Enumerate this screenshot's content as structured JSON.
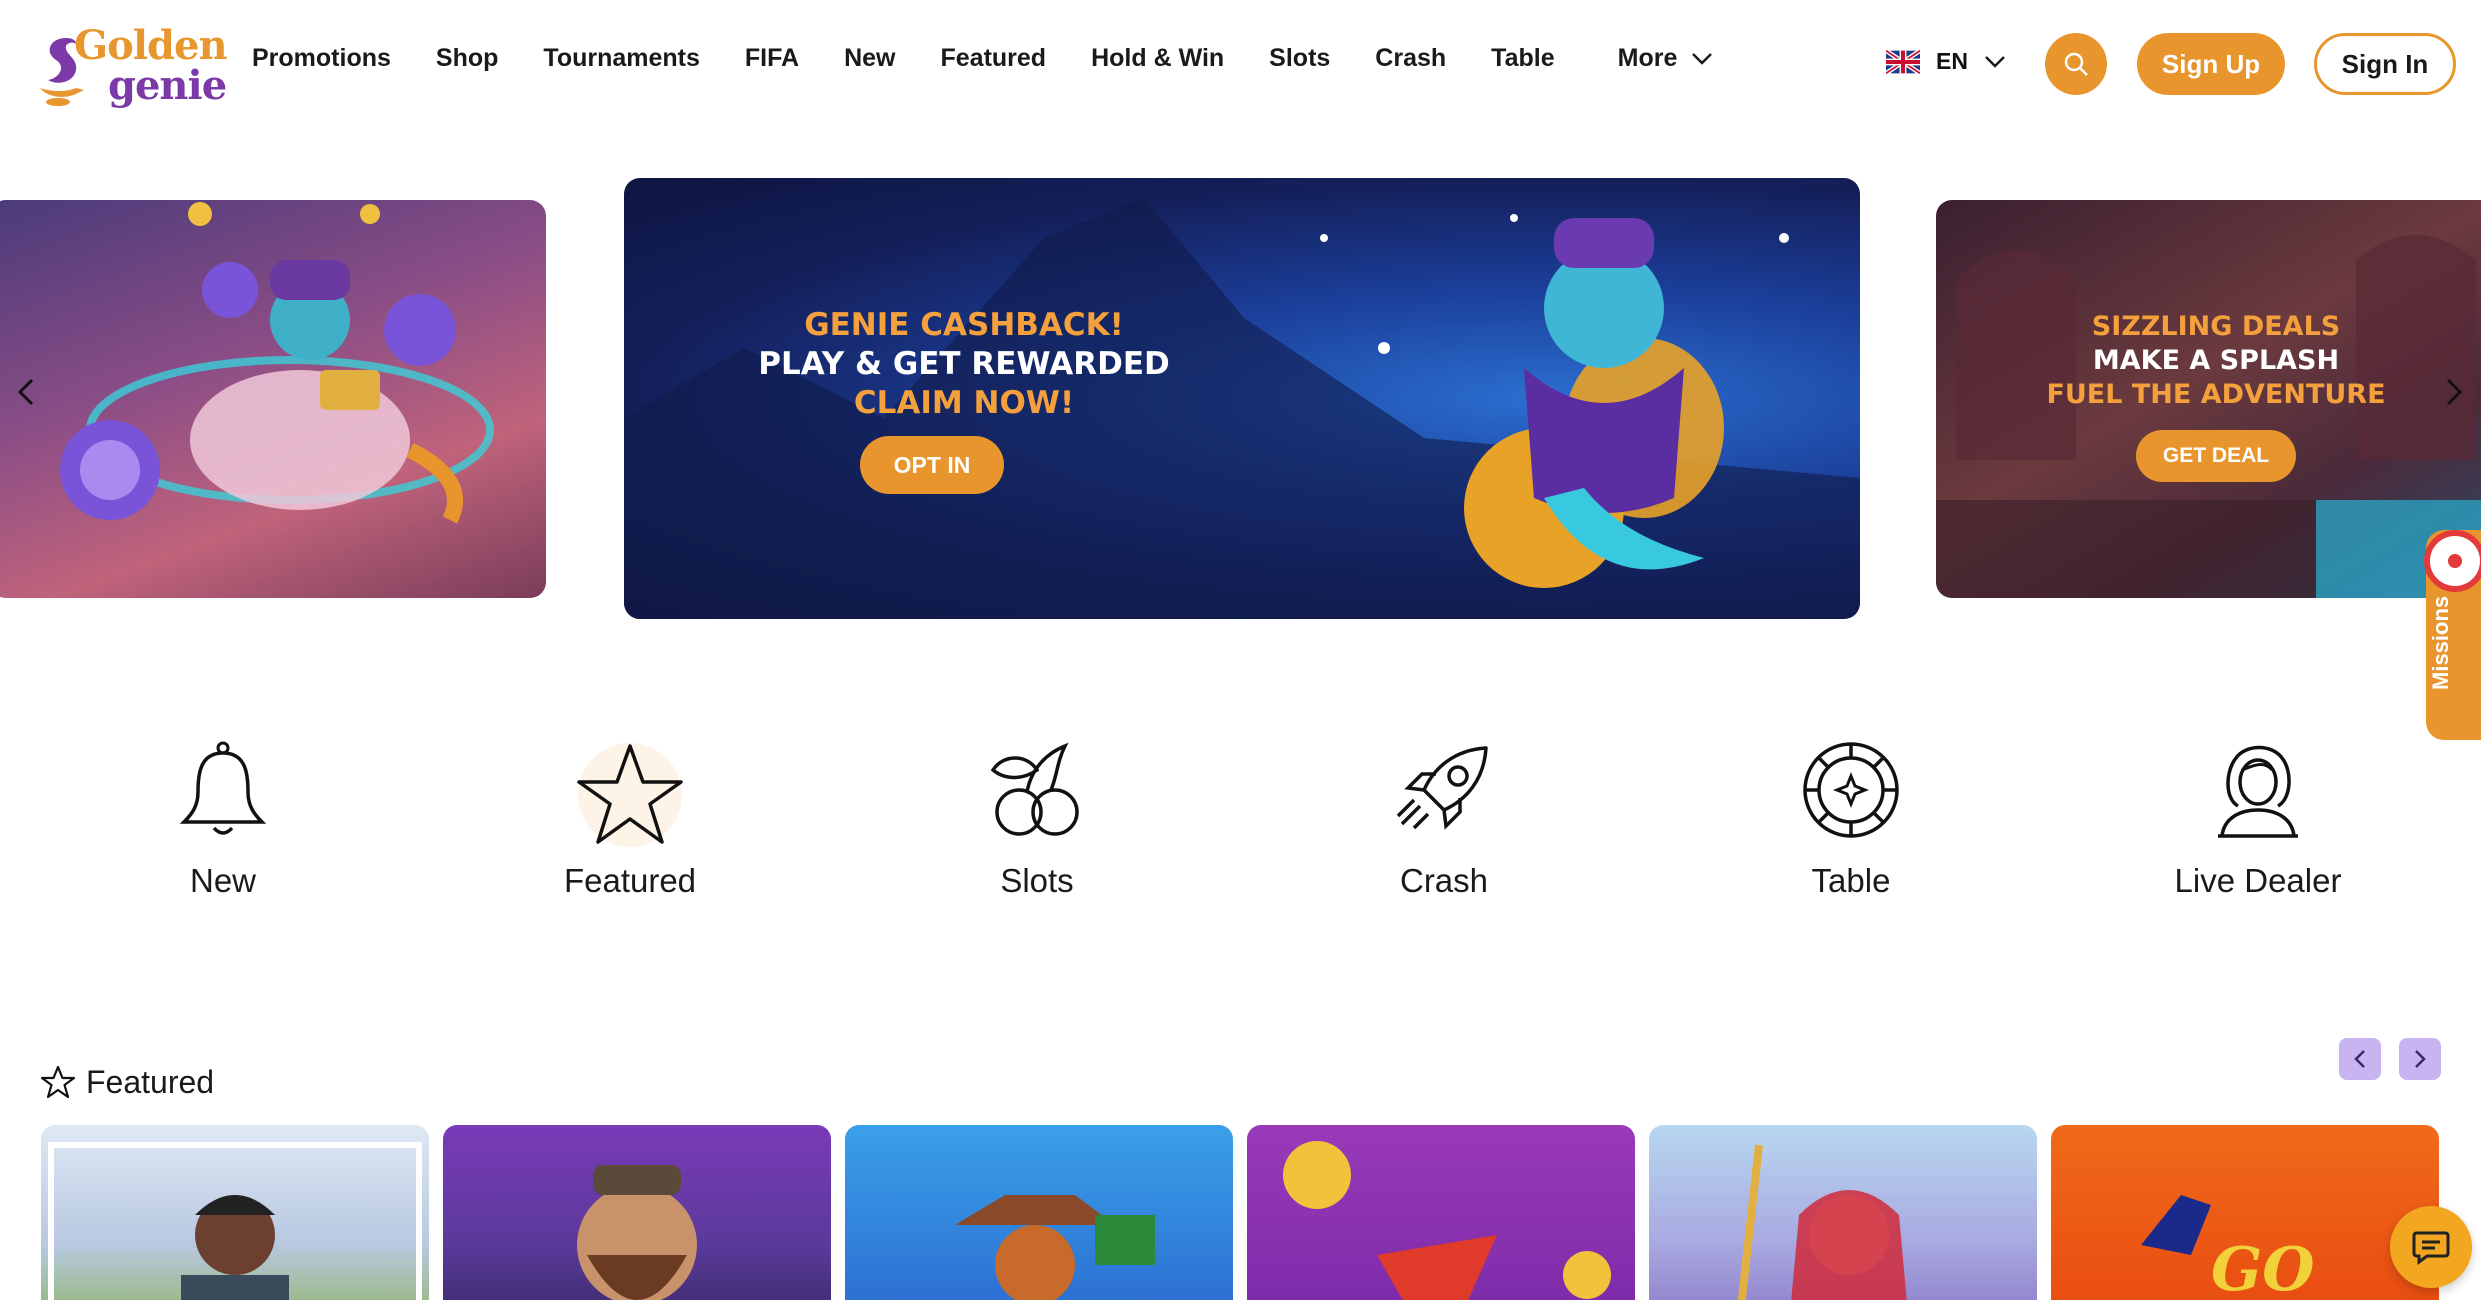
{
  "brand": {
    "line1": "Golden",
    "line2": "genie"
  },
  "nav": {
    "items": [
      "Promotions",
      "Shop",
      "Tournaments",
      "FIFA",
      "New",
      "Featured",
      "Hold & Win",
      "Slots",
      "Crash",
      "Table"
    ],
    "more_label": "More"
  },
  "header": {
    "language": "EN",
    "language_icon": "uk-flag-icon",
    "search_icon": "search-icon",
    "signup_label": "Sign Up",
    "signin_label": "Sign In"
  },
  "carousel": {
    "main": {
      "line1": "GENIE CASHBACK!",
      "line2": "PLAY & GET REWARDED",
      "line3": "CLAIM NOW!",
      "cta": "OPT IN"
    },
    "right": {
      "line1": "SIZZLING DEALS",
      "line2": "MAKE A SPLASH",
      "line3": "FUEL THE ADVENTURE",
      "cta": "GET DEAL"
    }
  },
  "missions": {
    "label": "Missions"
  },
  "categories": [
    {
      "label": "New",
      "icon": "bell-icon"
    },
    {
      "label": "Featured",
      "icon": "star-icon"
    },
    {
      "label": "Slots",
      "icon": "cherries-icon"
    },
    {
      "label": "Crash",
      "icon": "rocket-icon"
    },
    {
      "label": "Table",
      "icon": "roulette-icon"
    },
    {
      "label": "Live Dealer",
      "icon": "dealer-icon"
    }
  ],
  "featured": {
    "title": "Featured",
    "tiles": [
      {
        "text": ""
      },
      {
        "text": ""
      },
      {
        "text": ""
      },
      {
        "text": ""
      },
      {
        "text": ""
      },
      {
        "text": "GO"
      }
    ]
  },
  "colors": {
    "accent": "#e8952e",
    "brand_purple": "#7c3aa8",
    "pager": "#c8b4f0"
  }
}
